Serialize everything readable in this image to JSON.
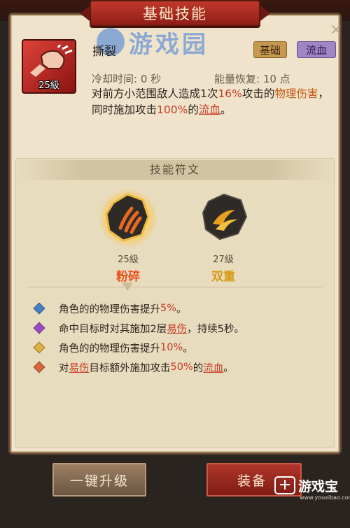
{
  "dialog": {
    "title": "基础技能",
    "close_icon": "×"
  },
  "skill": {
    "level": "25級",
    "name": "撕裂",
    "tags": [
      "基础",
      "流血"
    ],
    "cooldown": "冷却时间: 0 秒",
    "energy": "能量恢复: 10 点",
    "desc": {
      "p1": "对前方小范围敌人造成1次",
      "v1": "16%",
      "p2": "攻击的",
      "k1": "物理伤害",
      "p3": "，同时施加攻击",
      "v2": "100%",
      "p4": "的",
      "k2": "流血",
      "p5": "。"
    }
  },
  "runes": {
    "header": "技能符文",
    "items": [
      {
        "level": "25級",
        "name": "粉碎",
        "color": "#e8501c"
      },
      {
        "level": "27級",
        "name": "双重",
        "color": "#d89a10"
      }
    ]
  },
  "effects": [
    {
      "color": "#4a7ec8",
      "parts": [
        {
          "t": "角色的的物理伤害提升"
        },
        {
          "t": "5%",
          "c": "red"
        },
        {
          "t": "。"
        }
      ]
    },
    {
      "color": "#9a4ac8",
      "parts": [
        {
          "t": "命中目标时对其施加2层"
        },
        {
          "t": "易伤",
          "c": "link"
        },
        {
          "t": "，持续5秒。"
        }
      ]
    },
    {
      "color": "#e0b040",
      "parts": [
        {
          "t": "角色的的物理伤害提升"
        },
        {
          "t": "10%",
          "c": "red"
        },
        {
          "t": "。"
        }
      ]
    },
    {
      "color": "#d8683a",
      "parts": [
        {
          "t": "对"
        },
        {
          "t": "易伤",
          "c": "link"
        },
        {
          "t": "目标额外施加攻击"
        },
        {
          "t": "50%",
          "c": "red"
        },
        {
          "t": "的"
        },
        {
          "t": "流血",
          "c": "link"
        },
        {
          "t": "。"
        }
      ]
    }
  ],
  "buttons": {
    "upgrade": "一键升级",
    "equip": "装备"
  },
  "watermark": {
    "center": "游戏园",
    "corner": "游戏宝",
    "corner_sub": "www.youxibao.com"
  }
}
